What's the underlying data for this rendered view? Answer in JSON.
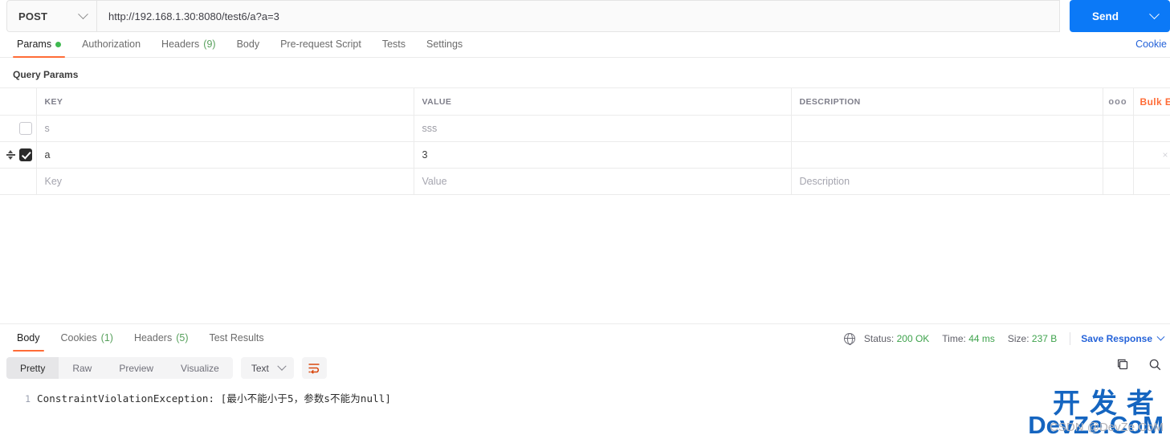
{
  "request": {
    "method": "POST",
    "url": "http://192.168.1.30:8080/test6/a?a=3",
    "send_label": "Send"
  },
  "request_tabs": {
    "items": [
      {
        "label": "Params",
        "active": true,
        "dot": true
      },
      {
        "label": "Authorization",
        "active": false
      },
      {
        "label": "Headers",
        "count": "(9)",
        "active": false
      },
      {
        "label": "Body",
        "active": false
      },
      {
        "label": "Pre-request Script",
        "active": false
      },
      {
        "label": "Tests",
        "active": false
      },
      {
        "label": "Settings",
        "active": false
      }
    ],
    "cookie_link": "Cookie"
  },
  "query_params": {
    "title": "Query Params",
    "columns": [
      "KEY",
      "VALUE",
      "DESCRIPTION"
    ],
    "bulk_edit_label": "Bulk Ed",
    "more_icon": "ooo",
    "rows": [
      {
        "checked": false,
        "key": "s",
        "value": "sss",
        "description": "",
        "placeholder": false,
        "drag": false
      },
      {
        "checked": true,
        "key": "a",
        "value": "3",
        "description": "",
        "placeholder": false,
        "drag": true,
        "delete_icon": "×"
      },
      {
        "checked": false,
        "key": "Key",
        "value": "Value",
        "description": "Description",
        "placeholder": true,
        "drag": false
      }
    ]
  },
  "response_tabs": {
    "items": [
      {
        "label": "Body",
        "active": true
      },
      {
        "label": "Cookies",
        "count": "(1)",
        "active": false
      },
      {
        "label": "Headers",
        "count": "(5)",
        "active": false
      },
      {
        "label": "Test Results",
        "active": false
      }
    ]
  },
  "response_meta": {
    "status_label": "Status:",
    "status_value": "200 OK",
    "time_label": "Time:",
    "time_value": "44 ms",
    "size_label": "Size:",
    "size_value": "237 B",
    "save_response": "Save Response"
  },
  "view_bar": {
    "modes": [
      {
        "label": "Pretty",
        "active": true
      },
      {
        "label": "Raw",
        "active": false
      },
      {
        "label": "Preview",
        "active": false
      },
      {
        "label": "Visualize",
        "active": false
      }
    ],
    "format": "Text",
    "wrap_icon": "wrap-lines-icon"
  },
  "response_body": {
    "lines": [
      {
        "number": "1",
        "text": "ConstraintViolationException: [最小不能小于5，参数s不能为null]"
      }
    ]
  },
  "watermark": {
    "cn": "开发者",
    "en": "DevZe.CoM",
    "csdn": "CSDN @DevZe.CoM"
  },
  "colors": {
    "accent_orange": "#ff6c37",
    "send_blue": "#0b79f7",
    "link_blue": "#2563d9",
    "status_green": "#3fa34d",
    "dot_green": "#3fb950",
    "watermark_blue": "#1565c0"
  }
}
